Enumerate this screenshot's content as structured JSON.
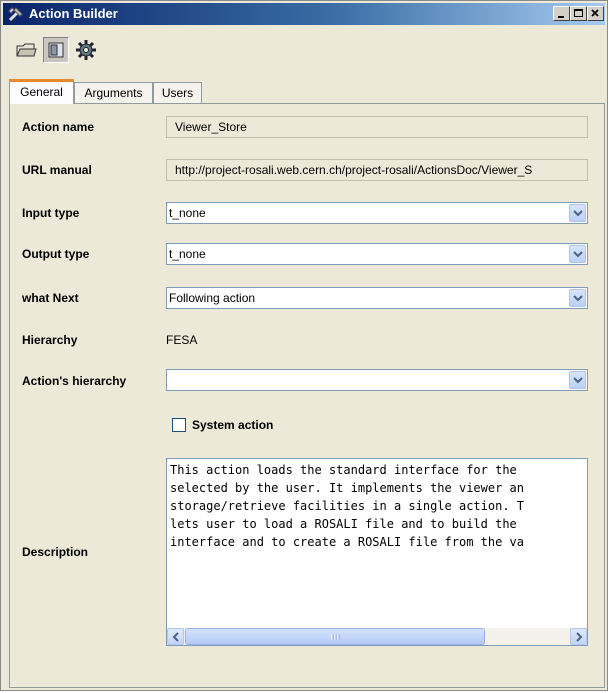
{
  "window": {
    "title": "Action Builder"
  },
  "toolbar": {
    "icons": [
      "open-folder-icon",
      "window-icon",
      "gear-icon"
    ]
  },
  "tabs": [
    {
      "label": "General",
      "active": true
    },
    {
      "label": "Arguments",
      "active": false
    },
    {
      "label": "Users",
      "active": false
    }
  ],
  "form": {
    "action_name_label": "Action name",
    "action_name_value": "Viewer_Store",
    "url_manual_label": "URL manual",
    "url_manual_value": "http://project-rosali.web.cern.ch/project-rosali/ActionsDoc/Viewer_S",
    "input_type_label": "Input type",
    "input_type_value": "t_none",
    "output_type_label": "Output type",
    "output_type_value": "t_none",
    "what_next_label": "what Next",
    "what_next_value": "Following action",
    "hierarchy_label": "Hierarchy",
    "hierarchy_value": "FESA",
    "action_hierarchy_label": "Action's hierarchy",
    "action_hierarchy_value": "",
    "system_action_label": "System action",
    "system_action_checked": false,
    "description_label": "Description",
    "description_value": "This action loads the standard interface for the\nselected by the user. It implements the viewer an\nstorage/retrieve facilities in a single action. T\nlets user to load a ROSALI file and to build the\ninterface and to create a ROSALI file from the va"
  },
  "colors": {
    "title_bar": "#0a246a",
    "active_tab_accent": "#e68b2c",
    "field_border": "#7f9db9"
  }
}
